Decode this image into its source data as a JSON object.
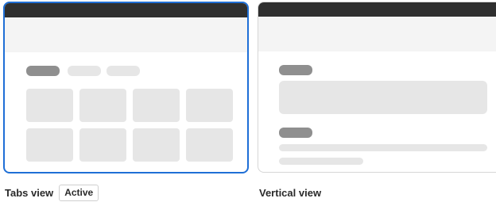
{
  "options": [
    {
      "label": "Tabs view",
      "badge": "Active",
      "selected": true
    },
    {
      "label": "Vertical view",
      "selected": false
    }
  ],
  "colors": {
    "selected_border": "#1f6fd6",
    "topbar": "#2f2f2f",
    "placeholder": "#e6e6e6",
    "placeholder_dark": "#8f8f8f"
  }
}
